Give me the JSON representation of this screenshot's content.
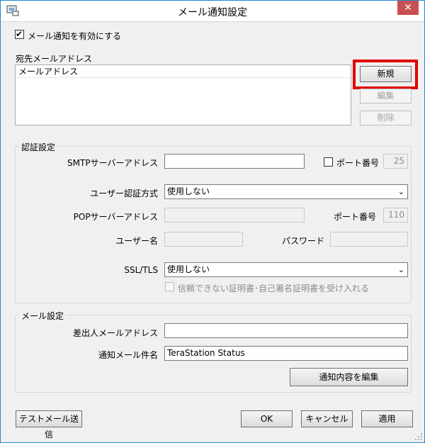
{
  "window": {
    "title": "メール通知設定",
    "close_label": "✕",
    "grip_icon": "resize-grip"
  },
  "notification": {
    "enable_label": "メール通知を有効にする",
    "enabled": true
  },
  "recipients": {
    "label": "宛先メールアドレス",
    "column_header": "メールアドレス",
    "new_button": "新規",
    "edit_button": "編集",
    "delete_button": "削除",
    "highlight_color": "#e00000"
  },
  "auth": {
    "group_title": "認証設定",
    "smtp_label": "SMTPサーバーアドレス",
    "smtp_value": "",
    "port_check_label": "ポート番号",
    "smtp_port": "25",
    "auth_method_label": "ユーザー認証方式",
    "auth_method_value": "使用しない",
    "pop_label": "POPサーバーアドレス",
    "pop_value": "",
    "pop_port_label": "ポート番号",
    "pop_port": "110",
    "username_label": "ユーザー名",
    "username_value": "",
    "password_label": "パスワード",
    "password_value": "",
    "ssl_label": "SSL/TLS",
    "ssl_value": "使用しない",
    "untrusted_cert_label": "信頼できない証明書･自己署名証明書を受け入れる"
  },
  "mail": {
    "group_title": "メール設定",
    "sender_label": "差出人メールアドレス",
    "sender_value": "",
    "subject_label": "通知メール件名",
    "subject_value": "TeraStation Status",
    "edit_content_button": "通知内容を編集"
  },
  "footer": {
    "test_mail_button": "テストメール送信",
    "ok_button": "OK",
    "cancel_button": "キャンセル",
    "apply_button": "適用"
  },
  "icons": {
    "app": "app-icon",
    "checkmark": "✔",
    "dropdown": "⌄"
  }
}
